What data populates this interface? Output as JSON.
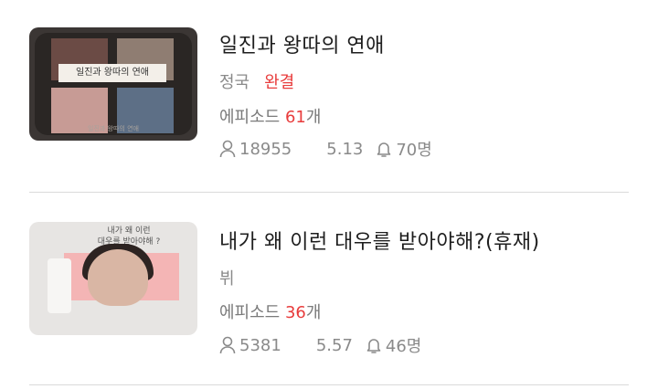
{
  "stories": [
    {
      "title": "일진과 왕따의 연애",
      "author": "정국",
      "status": "완결",
      "episodes_label": "에피소드",
      "episodes_count": "61",
      "episodes_unit": "개",
      "views": "18955",
      "date": "5.13",
      "subscribers": "70명",
      "thumbnail": {
        "banner_text": "일진과 왕따의 연애",
        "caption_text": "일진과 왕따의 연애"
      }
    },
    {
      "title": "내가 왜 이런 대우를 받아야해?(휴재)",
      "author": "뷔",
      "episodes_label": "에피소드",
      "episodes_count": "36",
      "episodes_unit": "개",
      "views": "5381",
      "date": "5.57",
      "subscribers": "46명",
      "thumbnail": {
        "header_line1": "내가 왜 이런",
        "header_line2": "대우를 받아야해 ?"
      }
    }
  ],
  "colors": {
    "accent_red": "#e83c3c",
    "muted_text": "#8a8a8a",
    "divider": "#dadada"
  }
}
